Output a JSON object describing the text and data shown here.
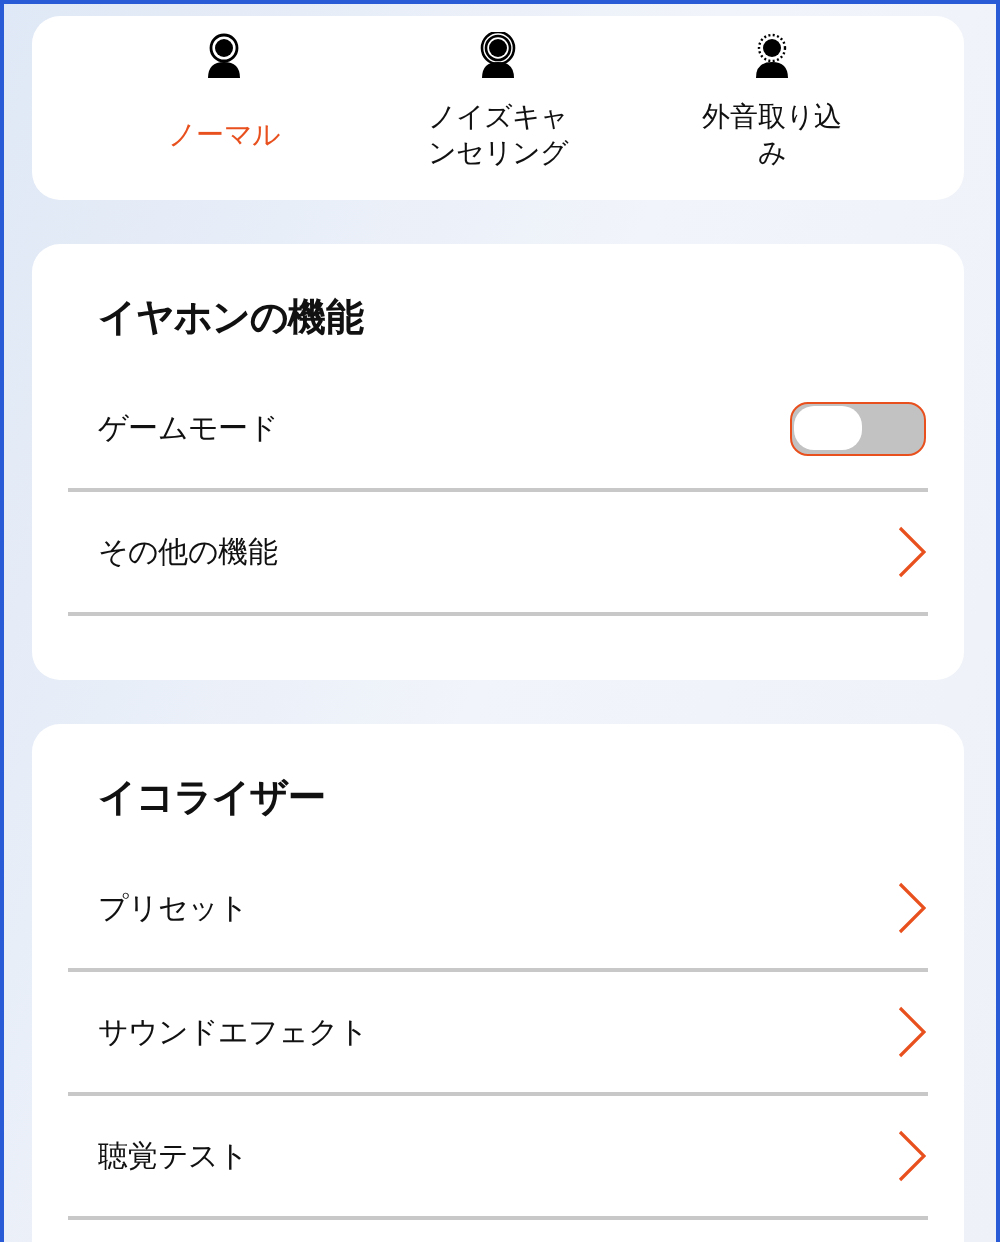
{
  "modes": [
    {
      "label": "ノーマル",
      "kind": "normal",
      "selected": true
    },
    {
      "label": "ノイズキャンセリング",
      "kind": "noise-cancel",
      "selected": false
    },
    {
      "label": "外音取り込み",
      "kind": "ambient",
      "selected": false
    }
  ],
  "sections": [
    {
      "title": "イヤホンの機能",
      "rows": [
        {
          "label": "ゲームモード",
          "kind": "toggle",
          "on": false
        },
        {
          "label": "その他の機能",
          "kind": "link"
        }
      ]
    },
    {
      "title": "イコライザー",
      "rows": [
        {
          "label": "プリセット",
          "kind": "link"
        },
        {
          "label": "サウンドエフェクト",
          "kind": "link"
        },
        {
          "label": "聴覚テスト",
          "kind": "link"
        }
      ]
    }
  ]
}
